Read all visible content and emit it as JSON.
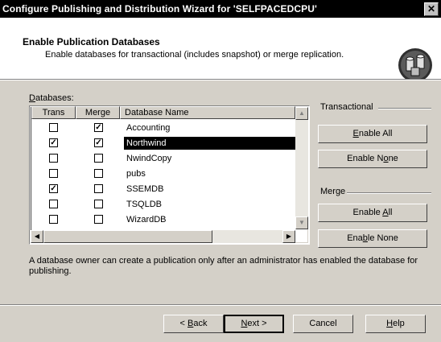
{
  "window": {
    "title": "Configure Publishing and Distribution Wizard for 'SELFPACEDCPU'",
    "close_label": "✕"
  },
  "header": {
    "title": "Enable Publication Databases",
    "subtitle": "Enable databases for transactional (includes snapshot) or merge replication."
  },
  "databases_label": "Databases:",
  "grid": {
    "columns": [
      "Trans",
      "Merge",
      "Database Name"
    ],
    "rows": [
      {
        "trans": false,
        "merge": true,
        "name": "Accounting"
      },
      {
        "trans": true,
        "merge": true,
        "name": "Northwind",
        "selected": true
      },
      {
        "trans": false,
        "merge": false,
        "name": "NwindCopy"
      },
      {
        "trans": false,
        "merge": false,
        "name": "pubs"
      },
      {
        "trans": true,
        "merge": false,
        "name": "SSEMDB"
      },
      {
        "trans": false,
        "merge": false,
        "name": "TSQLDB"
      },
      {
        "trans": false,
        "merge": false,
        "name": "WizardDB"
      }
    ]
  },
  "transactional": {
    "label": "Transactional",
    "enable_all": "Enable All",
    "enable_none": "Enable None"
  },
  "merge": {
    "label": "Merge",
    "enable_all": "Enable All",
    "enable_none": "Enable None"
  },
  "note": "A database owner can create a publication only after an administrator has enabled the database for publishing.",
  "footer": {
    "back": "< Back",
    "next": "Next >",
    "cancel": "Cancel",
    "help": "Help"
  }
}
